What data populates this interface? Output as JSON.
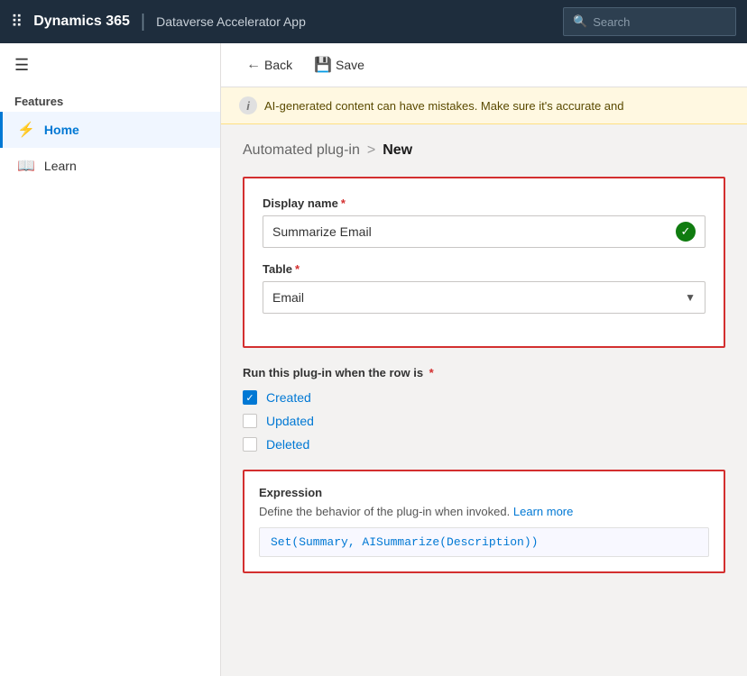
{
  "topNav": {
    "appTitle": "Dynamics 365",
    "appSubtitle": "Dataverse Accelerator App",
    "searchPlaceholder": "Search"
  },
  "sidebar": {
    "sectionLabel": "Features",
    "items": [
      {
        "id": "home",
        "label": "Home",
        "icon": "⚡",
        "active": true
      },
      {
        "id": "learn",
        "label": "Learn",
        "icon": "📖",
        "active": false
      }
    ]
  },
  "toolbar": {
    "backLabel": "Back",
    "saveLabel": "Save"
  },
  "warningBanner": {
    "text": "AI-generated content can have mistakes. Make sure it's accurate and"
  },
  "breadcrumb": {
    "parent": "Automated plug-in",
    "separator": ">",
    "current": "New"
  },
  "form": {
    "displayNameLabel": "Display name",
    "displayNameValue": "Summarize Email",
    "tableLabel": "Table",
    "tableValue": "Email",
    "runWhenLabel": "Run this plug-in when the row is",
    "checkboxes": [
      {
        "id": "created",
        "label": "Created",
        "checked": true
      },
      {
        "id": "updated",
        "label": "Updated",
        "checked": false
      },
      {
        "id": "deleted",
        "label": "Deleted",
        "checked": false
      }
    ]
  },
  "expression": {
    "title": "Expression",
    "description": "Define the behavior of the plug-in when invoked.",
    "linkText": "Learn more",
    "code": "Set(Summary, AISummarize(Description))"
  }
}
